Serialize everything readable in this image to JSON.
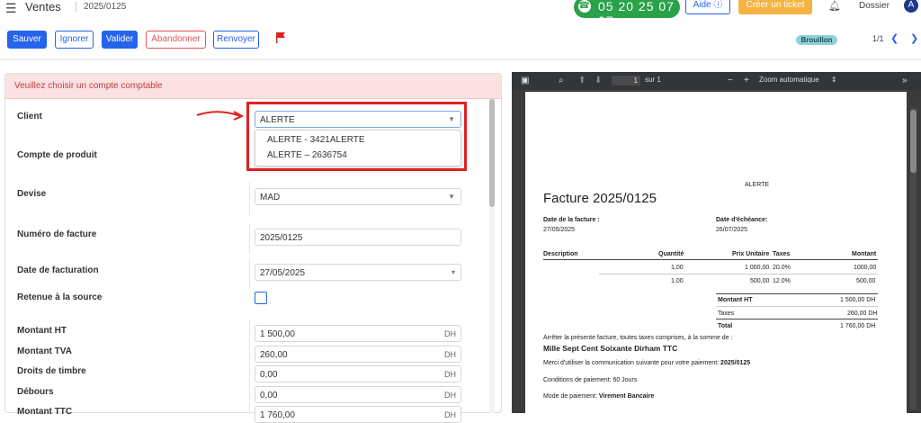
{
  "topbar": {
    "app_title": "Ventes",
    "breadcrumb": "2025/0125",
    "phone": "05 20 25 07 07",
    "help_label": "Aide ⓘ",
    "ticket_label": "Créer un ticket",
    "dossier_label": "Dossier",
    "avatar_letter": "A"
  },
  "toolbar": {
    "save": "Sauver",
    "ignore": "Ignorer",
    "validate": "Valider",
    "abandon": "Abandonner",
    "resend": "Renvoyer"
  },
  "status": {
    "badge": "Brouillon",
    "pager": "1/1"
  },
  "form": {
    "alert": "Veuillez choisir un compte comptable",
    "client_label": "Client",
    "client_value": "ALERTE",
    "client_options": [
      "ALERTE - 3421ALERTE",
      "ALERTE – 2636754"
    ],
    "product_account_label": "Compte de produit",
    "currency_label": "Devise",
    "currency_value": "MAD",
    "invoice_number_label": "Numéro de facture",
    "invoice_number_value": "2025/0125",
    "invoice_date_label": "Date de facturation",
    "invoice_date_value": "27/05/2025",
    "withholding_label": "Retenue à la source",
    "amount_ht_label": "Montant HT",
    "amount_ht_value": "1 500,00",
    "vat_label": "Montant TVA",
    "vat_value": "260,00",
    "stamp_label": "Droits de timbre",
    "stamp_value": "0,00",
    "disbursements_label": "Débours",
    "disbursements_value": "0,00",
    "amount_ttc_label": "Montant TTC",
    "amount_ttc_value": "1 760,00",
    "currency_suffix": "DH"
  },
  "pdf": {
    "page_current": "1",
    "page_total": "sur 1",
    "zoom": "Zoom automatique",
    "company": "ALERTE",
    "title": "Facture 2025/0125",
    "date_label": "Date de la facture :",
    "date_value": "27/05/2025",
    "due_label": "Date d'échéance:",
    "due_value": "26/07/2025",
    "col_description": "Description",
    "col_quantity": "Quantité",
    "col_unit_price": "Prix Unitaire",
    "col_taxes": "Taxes",
    "col_amount": "Montant",
    "rows": [
      {
        "qty": "1,00",
        "price": "1 000,00",
        "tax": "20.0%",
        "amount": "1000,00"
      },
      {
        "qty": "1,00",
        "price": "500,00",
        "tax": "12.0%",
        "amount": "500,00"
      }
    ],
    "total_ht_label": "Montant HT",
    "total_ht_value": "1 500,00 DH",
    "taxes_label": "Taxes",
    "taxes_value": "260,00 DH",
    "total_label": "Total",
    "total_value": "1 760,00 DH",
    "stop_text": "Arrêter la présente facture, toutes taxes comprises, à la somme de :",
    "amount_words": "Mille Sept Cent Soixante Dirham TTC",
    "comm_text": "Merci d'utiliser la communication suivante pour votre paiement:",
    "comm_ref": "2025/0125",
    "terms": "Conditions de paiement: 60 Jours",
    "payment_mode_label": "Mode de paiement:",
    "payment_mode_value": "Virement Bancaire"
  }
}
